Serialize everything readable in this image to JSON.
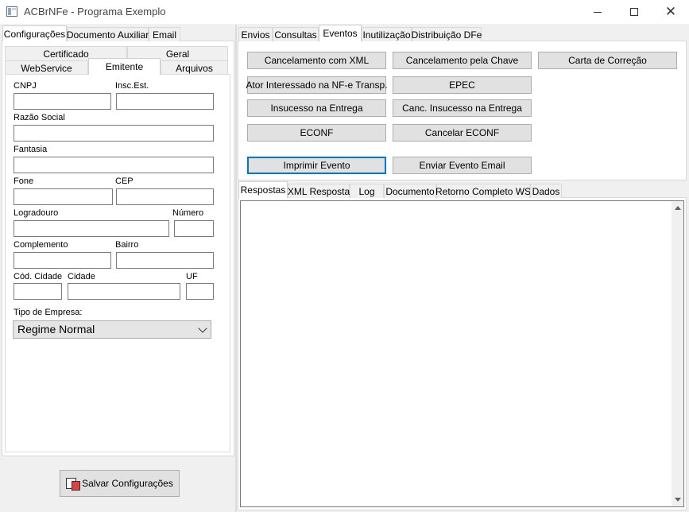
{
  "window": {
    "title": "ACBrNFe - Programa Exemplo"
  },
  "left": {
    "tabs": [
      "Configurações",
      "Documento Auxiliar",
      "Email"
    ],
    "subtabs_row1": [
      "Certificado",
      "Geral"
    ],
    "subtabs_row2": [
      "WebService",
      "Emitente",
      "Arquivos"
    ],
    "fields": {
      "cnpj": "CNPJ",
      "insc_est": "Insc.Est.",
      "razao_social": "Razão Social",
      "fantasia": "Fantasia",
      "fone": "Fone",
      "cep": "CEP",
      "logradouro": "Logradouro",
      "numero": "Número",
      "complemento": "Complemento",
      "bairro": "Bairro",
      "cod_cidade": "Cód. Cidade",
      "cidade": "Cidade",
      "uf": "UF",
      "tipo_empresa": "Tipo de Empresa:"
    },
    "tipo_empresa_value": "Regime Normal",
    "save_label": "Salvar Configurações"
  },
  "right": {
    "tabs": [
      "Envios",
      "Consultas",
      "Eventos",
      "Inutilização",
      "Distribuição DFe"
    ],
    "buttons": {
      "cancel_xml": "Cancelamento com XML",
      "cancel_chave": "Cancelamento pela Chave",
      "carta_correcao": "Carta de Correção",
      "ator_interessado": "Ator Interessado na NF-e Transp.",
      "epec": "EPEC",
      "insucesso": "Insucesso na Entrega",
      "canc_insucesso": "Canc. Insucesso na Entrega",
      "econf": "ECONF",
      "cancelar_econf": "Cancelar ECONF",
      "imprimir_evento": "Imprimir Evento",
      "enviar_evento_email": "Enviar Evento Email"
    },
    "resp_tabs": [
      "Respostas",
      "XML Resposta",
      "Log",
      "Documento",
      "Retorno Completo WS",
      "Dados"
    ]
  }
}
